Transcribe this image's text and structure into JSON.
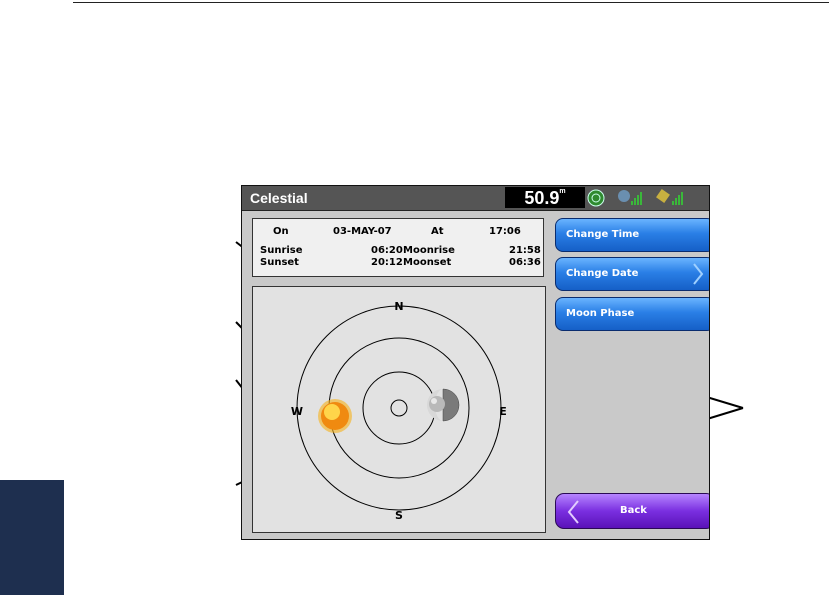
{
  "window": {
    "title": "Celestial"
  },
  "status_bar": {
    "value": "50.9",
    "unit": "m",
    "icons": [
      "sonar-icon",
      "gps-signal-icon",
      "satellite-signal-icon"
    ]
  },
  "info": {
    "on_label": "On",
    "date": "03-MAY-07",
    "at_label": "At",
    "time": "17:06",
    "sunrise_label": "Sunrise",
    "sunrise": "06:20",
    "sunset_label": "Sunset",
    "sunset": "20:12",
    "moonrise_label": "Moonrise",
    "moonrise": "21:58",
    "moonset_label": "Moonset",
    "moonset": "06:36"
  },
  "sky": {
    "north": "N",
    "south": "S",
    "east": "E",
    "west": "W"
  },
  "menu": {
    "change_time": "Change Time",
    "change_date": "Change Date",
    "moon_phase": "Moon Phase",
    "back": "Back"
  },
  "colors": {
    "button_blue": "#2a7fe6",
    "back_purple": "#7a2fe0",
    "title_bar": "#555555",
    "side_tab": "#1e2f4f"
  }
}
